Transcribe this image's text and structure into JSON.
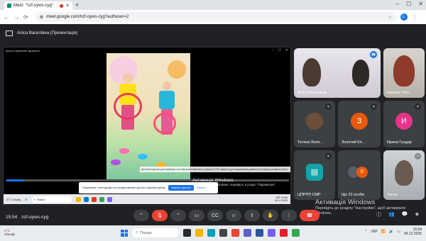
{
  "browser": {
    "tab_title": "Meet: \"nzf-oyws-cyg\"",
    "url": "meet.google.com/nzf-oyws-cyg?authuser=2",
    "profile_initial": "L"
  },
  "meet": {
    "presenter_title": "Аліса Василівна (Презентація)",
    "meeting_time": "15:54",
    "meeting_code": "nzf-oyws-cyg"
  },
  "presentation": {
    "header_text": "школа сприяння здоров'ю",
    "caption": "Дитячий садочок для перевірки та поліпшення фізичного розвитку СТВ: педагоги для покращення розвитку моторики в розвитку міста",
    "activation_title": "Активація Windows",
    "activation_text": "Щоб активувати Windows, перейдіть в розділ \"Параметри\".",
    "share_notice": "Призначено: meet.google.com предоставляет доступ к вашему экрану.",
    "share_button": "Закрыть доступ",
    "hide_button": "Скрыть",
    "inner_weather_temp": "3°C",
    "inner_weather_text": "Cloudy",
    "inner_search": "Поиск",
    "inner_lang": "УКР",
    "inner_time": "15:54",
    "inner_date": "04.12.2025"
  },
  "participants": [
    {
      "name": "Аліса Василівна",
      "type": "photo"
    },
    {
      "name": "Наталя Голо...",
      "type": "photo"
    },
    {
      "name": "Тетяна Леля...",
      "type": "photo"
    },
    {
      "name": "Золотий Кл...",
      "type": "initial",
      "initial": "З",
      "color": "#e8590c"
    },
    {
      "name": "Ирина Гундар",
      "type": "initial",
      "initial": "И",
      "color": "#e8338b"
    },
    {
      "name": "ЦПРПП СМР",
      "type": "icon",
      "color": "#12a4a7"
    },
    {
      "name": "Ще 23 особи",
      "type": "more",
      "count": "0"
    },
    {
      "name": "Ганна",
      "type": "photo"
    }
  ],
  "activation": {
    "title": "Активація Windows",
    "text1": "Перейдіть до розділу \"Настройки\", щоб активувати",
    "text2": "Windows."
  },
  "taskbar": {
    "weather_temp": "3°C",
    "weather_text": "Cloudy",
    "search_placeholder": "Пошук",
    "lang": "УКР",
    "time": "15:54",
    "date": "04.12.2025"
  },
  "icons": {
    "mic_off": "mic-off-icon",
    "camera": "camera-icon",
    "captions": "captions-icon",
    "emoji": "emoji-icon",
    "present": "present-icon",
    "hand": "raise-hand-icon",
    "more": "more-icon",
    "end_call": "end-call-icon"
  }
}
